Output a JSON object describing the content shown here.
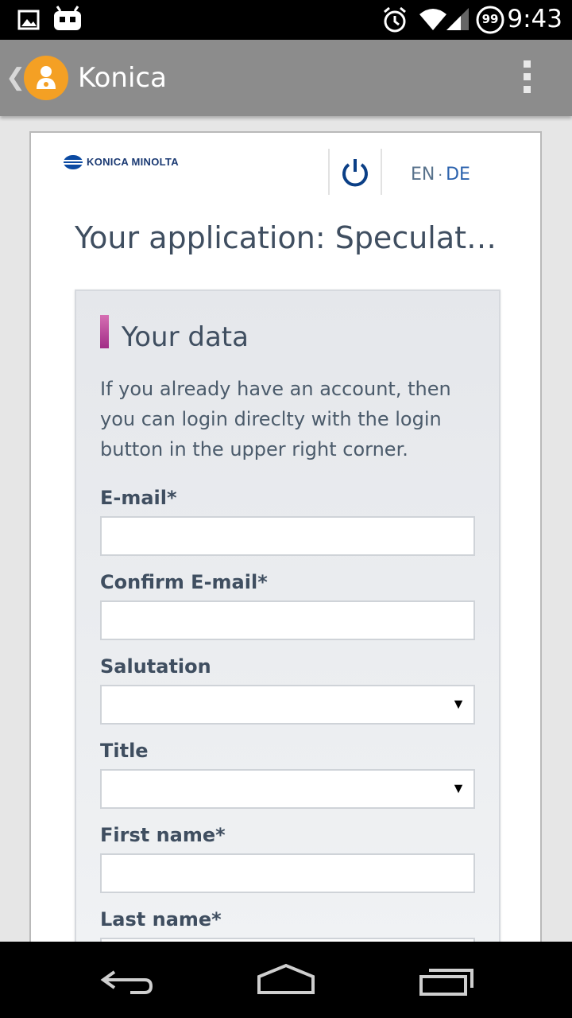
{
  "status_bar": {
    "time": "9:43",
    "battery_level": "99",
    "icons": [
      "gallery-icon",
      "android-robot-icon",
      "alarm-icon",
      "wifi-icon",
      "signal-icon",
      "battery-icon"
    ]
  },
  "action_bar": {
    "title": "Konica",
    "icons": [
      "back-chevron-icon",
      "app-avatar-icon",
      "overflow-menu-icon"
    ],
    "colors": {
      "background": "#8c8c8c",
      "app_icon": "#f4a024"
    }
  },
  "header": {
    "brand": "KONICA MINOLTA",
    "lang_en": "EN",
    "lang_separator": "·",
    "lang_de": "DE",
    "icons": [
      "konica-logo-icon",
      "power-icon"
    ]
  },
  "page_title": "Your application: Speculativ…",
  "form": {
    "heading": "Your data",
    "description": "If you already have an account, then you can login direclty with the login button in the upper right corner.",
    "fields": [
      {
        "label": "E-mail*",
        "type": "text",
        "value": ""
      },
      {
        "label": "Confirm E-mail*",
        "type": "text",
        "value": ""
      },
      {
        "label": "Salutation",
        "type": "select",
        "value": ""
      },
      {
        "label": "Title",
        "type": "select",
        "value": ""
      },
      {
        "label": "First name*",
        "type": "text",
        "value": ""
      },
      {
        "label": "Last name*",
        "type": "text",
        "value": ""
      }
    ],
    "select_arrow": "▼",
    "colors": {
      "accent": "#b03b91",
      "text": "#3f4e60"
    }
  },
  "nav_bar": {
    "icons": [
      "back-icon",
      "home-icon",
      "recent-apps-icon"
    ]
  }
}
